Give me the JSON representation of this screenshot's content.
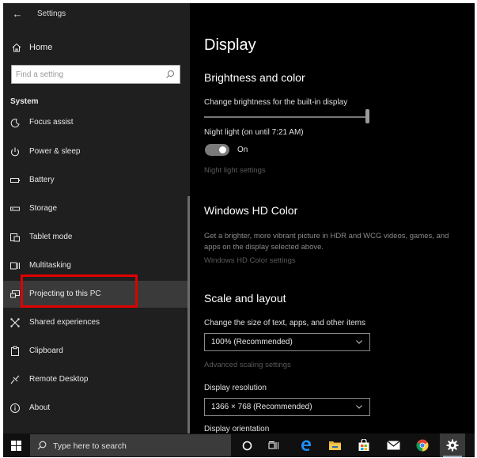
{
  "window": {
    "title": "Settings"
  },
  "sidebar": {
    "home_label": "Home",
    "search_placeholder": "Find a setting",
    "section_label": "System",
    "items": [
      {
        "label": "Focus assist",
        "icon": "focus-assist-icon"
      },
      {
        "label": "Power & sleep",
        "icon": "power-icon"
      },
      {
        "label": "Battery",
        "icon": "battery-icon"
      },
      {
        "label": "Storage",
        "icon": "storage-icon"
      },
      {
        "label": "Tablet mode",
        "icon": "tablet-mode-icon"
      },
      {
        "label": "Multitasking",
        "icon": "multitasking-icon"
      },
      {
        "label": "Projecting to this PC",
        "icon": "projecting-icon",
        "selected": true
      },
      {
        "label": "Shared experiences",
        "icon": "shared-experiences-icon"
      },
      {
        "label": "Clipboard",
        "icon": "clipboard-icon"
      },
      {
        "label": "Remote Desktop",
        "icon": "remote-desktop-icon"
      },
      {
        "label": "About",
        "icon": "info-icon"
      }
    ],
    "highlight_color": "#e00000"
  },
  "main": {
    "page_title": "Display",
    "brightness": {
      "heading": "Brightness and color",
      "slider_label": "Change brightness for the built-in display",
      "night_light_label": "Night light (on until 7:21 AM)",
      "night_light_state": "On",
      "night_light_settings_link": "Night light settings"
    },
    "hdr": {
      "heading": "Windows HD Color",
      "description": "Get a brighter, more vibrant picture in HDR and WCG videos, games, and apps on the display selected above.",
      "settings_link": "Windows HD Color settings"
    },
    "scale": {
      "heading": "Scale and layout",
      "size_label": "Change the size of text, apps, and other items",
      "size_value": "100% (Recommended)",
      "advanced_link": "Advanced scaling settings",
      "resolution_label": "Display resolution",
      "resolution_value": "1366 × 768 (Recommended)",
      "orientation_label": "Display orientation"
    }
  },
  "taskbar": {
    "search_placeholder": "Type here to search",
    "icons": [
      "windows-start-icon",
      "cortana-icon",
      "task-view-icon",
      "edge-icon",
      "file-explorer-icon",
      "store-icon",
      "mail-icon",
      "chrome-icon",
      "settings-icon"
    ]
  }
}
